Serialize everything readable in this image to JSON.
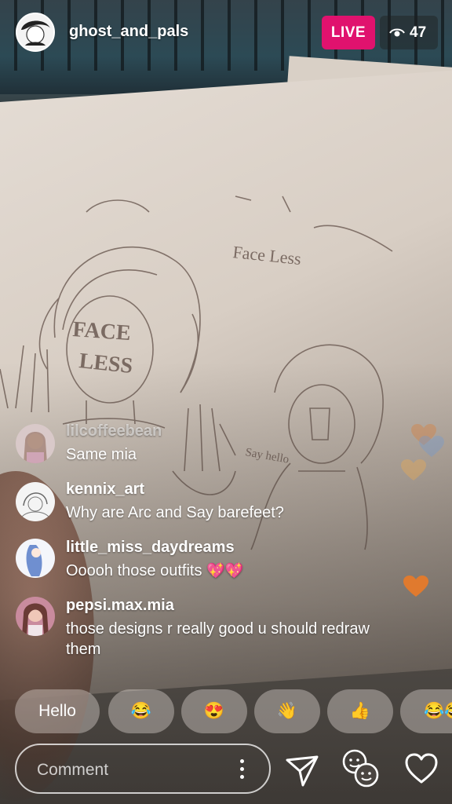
{
  "header": {
    "username": "ghost_and_pals",
    "live_label": "LIVE",
    "viewer_count": "47"
  },
  "comments": [
    {
      "username": "lilcoffeebean",
      "text": "Same mia",
      "faded": true
    },
    {
      "username": "kennix_art",
      "text": "Why are Arc and Say barefeet?"
    },
    {
      "username": "little_miss_daydreams",
      "text": "Ooooh those outfits",
      "emoji": "💖💖"
    },
    {
      "username": "pepsi.max.mia",
      "text": "those designs r really good u should redraw them"
    }
  ],
  "quick_reactions": [
    "Hello",
    "😂",
    "😍",
    "👋",
    "👍",
    "😂😂"
  ],
  "comment_input": {
    "placeholder": "Comment"
  },
  "sketch_labels": [
    "Face Less",
    "FACE LESS",
    "Say hello"
  ],
  "colors": {
    "live_badge": "#e0126e",
    "heart_orange": "#e07a2e"
  },
  "icons": [
    "eye-icon",
    "more-options-icon",
    "send-icon",
    "faces-icon",
    "heart-icon"
  ]
}
